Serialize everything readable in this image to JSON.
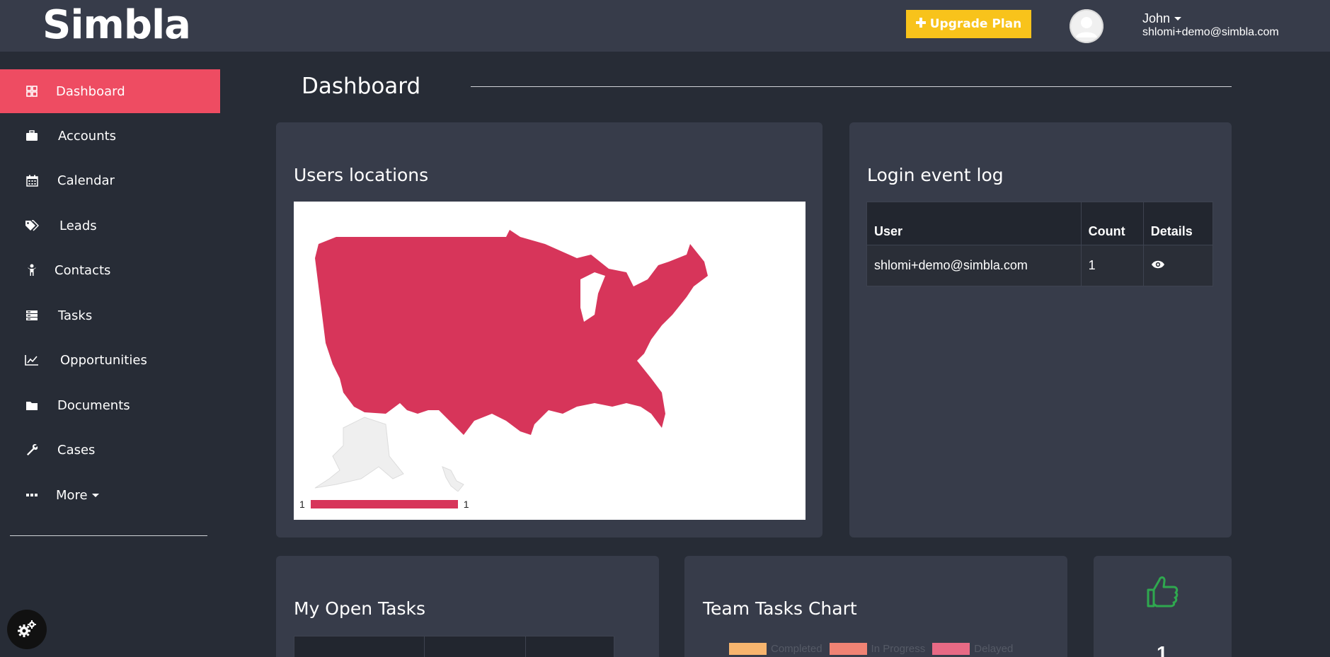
{
  "header": {
    "logo_text": "Simbla",
    "upgrade_label": "Upgrade Plan",
    "upgrade_color": "#f8c31b",
    "user_name": "John",
    "user_email": "shlomi+demo@simbla.com"
  },
  "sidebar": {
    "accent_color": "#ee4c62",
    "items": [
      {
        "label": "Dashboard",
        "icon": "dashboard-icon"
      },
      {
        "label": "Accounts",
        "icon": "briefcase-icon"
      },
      {
        "label": "Calendar",
        "icon": "calendar-icon"
      },
      {
        "label": "Leads",
        "icon": "tags-icon"
      },
      {
        "label": "Contacts",
        "icon": "person-icon"
      },
      {
        "label": "Tasks",
        "icon": "tasks-icon"
      },
      {
        "label": "Opportunities",
        "icon": "line-chart-icon"
      },
      {
        "label": "Documents",
        "icon": "folder-icon"
      },
      {
        "label": "Cases",
        "icon": "wrench-icon"
      },
      {
        "label": "More",
        "icon": "ellipsis-icon"
      }
    ]
  },
  "main": {
    "page_title": "Dashboard",
    "users_locations": {
      "title": "Users locations",
      "legend_min": "1",
      "legend_max": "1",
      "fill_color": "#d7355a"
    },
    "login_log": {
      "title": "Login event log",
      "columns": [
        "User",
        "Count",
        "Details"
      ],
      "rows": [
        {
          "user": "shlomi+demo@simbla.com",
          "count": "1"
        }
      ]
    },
    "open_tasks": {
      "title": "My Open Tasks"
    },
    "team_tasks": {
      "title": "Team Tasks Chart",
      "legend": [
        {
          "label": "Completed",
          "color": "#f7b56e"
        },
        {
          "label": "In Progress",
          "color": "#f08374"
        },
        {
          "label": "Delayed",
          "color": "#e86a85"
        }
      ]
    },
    "stat": {
      "value": "1",
      "icon_color": "#2fa84f"
    }
  }
}
